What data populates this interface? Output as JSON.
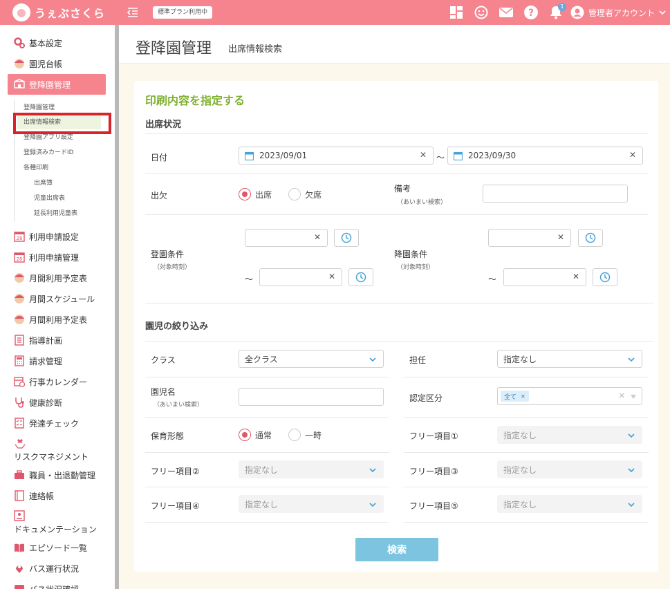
{
  "app": {
    "name": "うぇぶさくら",
    "plan_badge": "標準プラン利用中",
    "notifications_count": "1",
    "account_label": "管理者アカウント"
  },
  "icons": {
    "menu": "menu-collapse-icon",
    "dashboard": "dashboard-icon",
    "smile": "smile-icon",
    "mail": "mail-icon",
    "help": "help-icon",
    "bell": "bell-icon",
    "account": "account-icon"
  },
  "colors": {
    "brand": "#f6848f",
    "accent_green": "#7fb131",
    "search_button": "#7cc4e0",
    "radio_active": "#e0566a",
    "highlight_red": "#d9232b"
  },
  "sidebar": {
    "items": [
      {
        "label": "基本設定",
        "icon": "gears-icon"
      },
      {
        "label": "園児台帳",
        "icon": "child-icon"
      },
      {
        "label": "登降園管理",
        "icon": "attendance-icon",
        "active": true
      },
      {
        "label": "利用申請設定",
        "icon": "calendar-28-icon"
      },
      {
        "label": "利用申請管理",
        "icon": "calendar-28-icon"
      },
      {
        "label": "月間利用予定表",
        "icon": "child-icon"
      },
      {
        "label": "月間スケジュール",
        "icon": "child-icon"
      },
      {
        "label": "月間利用予定表",
        "icon": "child-icon"
      },
      {
        "label": "指導計画",
        "icon": "notebook-icon"
      },
      {
        "label": "請求管理",
        "icon": "calculator-icon"
      },
      {
        "label": "行事カレンダー",
        "icon": "calendar-event-icon"
      },
      {
        "label": "健康診断",
        "icon": "stethoscope-icon"
      },
      {
        "label": "発達チェック",
        "icon": "checklist-icon"
      },
      {
        "label": "リスクマネジメント",
        "icon": "hands-heart-icon"
      },
      {
        "label": "職員・出退勤管理",
        "icon": "briefcase-icon"
      },
      {
        "label": "連絡帳",
        "icon": "notebook-icon"
      },
      {
        "label": "ドキュメンテーション",
        "icon": "document-icon"
      },
      {
        "label": "エピソード一覧",
        "icon": "book-open-icon"
      },
      {
        "label": "バス運行状況",
        "icon": "bus-location-icon"
      },
      {
        "label": "バス状況確認",
        "icon": "bus-icon"
      }
    ],
    "sub_items": [
      {
        "label": "登降園管理"
      },
      {
        "label": "出席情報検索",
        "active": true
      },
      {
        "label": "登降園アプリ設定"
      },
      {
        "label": "登録済みカードID"
      },
      {
        "label": "各種印刷"
      },
      {
        "label": "出席簿"
      },
      {
        "label": "児童出席表"
      },
      {
        "label": "延長利用児童表"
      }
    ]
  },
  "header": {
    "title": "登降園管理",
    "subtitle": "出席情報検索"
  },
  "form": {
    "card_title": "印刷内容を指定する",
    "attendance_section": "出席状況",
    "date_label": "日付",
    "date_from": "2023/09/01",
    "date_to": "2023/09/30",
    "range_sep": "～",
    "presence_label": "出欠",
    "presence_options": [
      "出席",
      "欠席"
    ],
    "presence_selected": "出席",
    "remarks_label": "備考",
    "remarks_note": "（あいまい検索）",
    "remarks_value": "",
    "arrival_label": "登園条件",
    "arrival_note": "（対象時刻）",
    "departure_label": "降園条件",
    "departure_note": "（対象時刻）",
    "time_tilde": "～",
    "child_section": "園児の絞り込み",
    "class_label": "クラス",
    "class_value": "全クラス",
    "teacher_label": "担任",
    "teacher_value": "指定なし",
    "child_name_label": "園児名",
    "child_name_note": "（あいまい検索）",
    "cert_label": "認定区分",
    "cert_tag": "全て",
    "care_label": "保育形態",
    "care_options": [
      "通常",
      "一時"
    ],
    "care_selected": "通常",
    "free1_label": "フリー項目①",
    "free2_label": "フリー項目②",
    "free3_label": "フリー項目③",
    "free4_label": "フリー項目④",
    "free5_label": "フリー項目⑤",
    "free_value": "指定なし",
    "search_button": "検索"
  }
}
